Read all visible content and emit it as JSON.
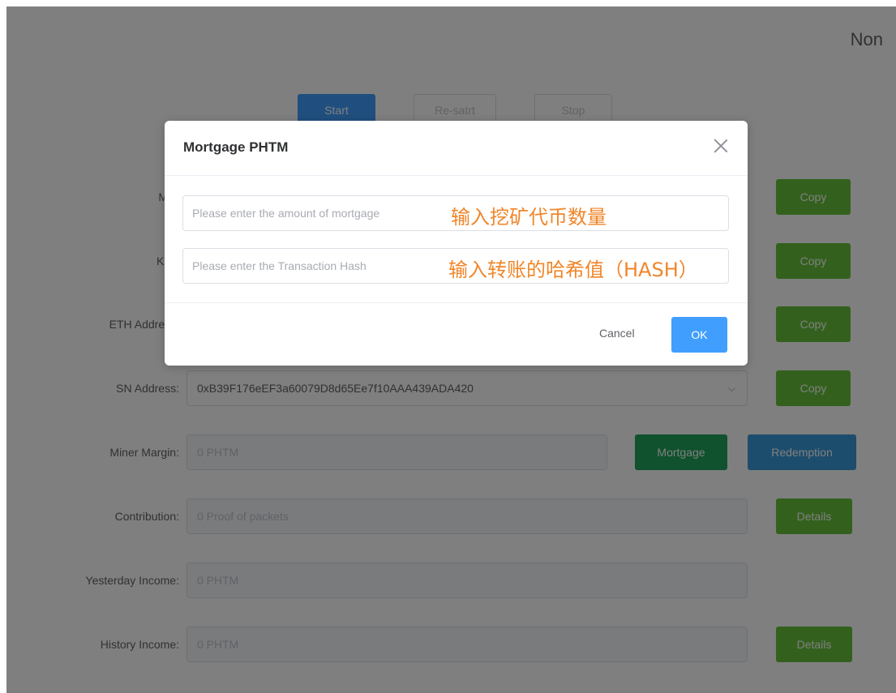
{
  "status": "Non",
  "controls": {
    "start": "Start",
    "restart": "Re-satrt",
    "stop": "Stop"
  },
  "rows": {
    "mid": {
      "label": "MID",
      "copy": "Copy"
    },
    "key": {
      "label": "KEY",
      "copy": "Copy"
    },
    "eth": {
      "label": "ETH Address:",
      "copy": "Copy"
    },
    "sn": {
      "label": "SN Address:",
      "value": "0xB39F176eEF3a60079D8d65Ee7f10AAA439ADA420",
      "copy": "Copy"
    },
    "margin": {
      "label": "Miner Margin:",
      "value": "0 PHTM",
      "mortgage": "Mortgage",
      "redemption": "Redemption"
    },
    "contribution": {
      "label": "Contribution:",
      "value": "0 Proof of packets",
      "details": "Details"
    },
    "yesterday": {
      "label": "Yesterday Income:",
      "value": "0 PHTM"
    },
    "history": {
      "label": "History Income:",
      "value": "0 PHTM",
      "details": "Details"
    }
  },
  "dialog": {
    "title": "Mortgage PHTM",
    "amount_placeholder": "Please enter the amount of mortgage",
    "hash_placeholder": "Please enter the Transaction Hash",
    "amount_annotation": "输入挖矿代币数量",
    "hash_annotation": "输入转账的哈希值（HASH）",
    "cancel": "Cancel",
    "ok": "OK"
  },
  "colors": {
    "primary": "#409eff",
    "success": "#67c23a",
    "annotation": "#f0862a"
  }
}
